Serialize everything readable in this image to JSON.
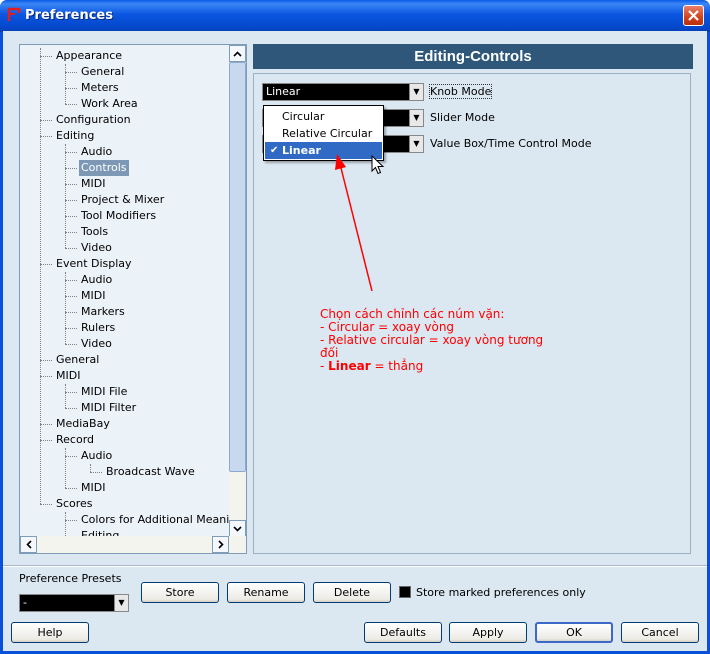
{
  "window": {
    "title": "Preferences"
  },
  "tree": {
    "items": [
      {
        "label": "Appearance",
        "level": 1
      },
      {
        "label": "General",
        "level": 2
      },
      {
        "label": "Meters",
        "level": 2
      },
      {
        "label": "Work Area",
        "level": 2
      },
      {
        "label": "Configuration",
        "level": 1
      },
      {
        "label": "Editing",
        "level": 1
      },
      {
        "label": "Audio",
        "level": 2
      },
      {
        "label": "Controls",
        "level": 2,
        "selected": true
      },
      {
        "label": "MIDI",
        "level": 2
      },
      {
        "label": "Project & Mixer",
        "level": 2
      },
      {
        "label": "Tool Modifiers",
        "level": 2
      },
      {
        "label": "Tools",
        "level": 2
      },
      {
        "label": "Video",
        "level": 2
      },
      {
        "label": "Event Display",
        "level": 1
      },
      {
        "label": "Audio",
        "level": 2
      },
      {
        "label": "MIDI",
        "level": 2
      },
      {
        "label": "Markers",
        "level": 2
      },
      {
        "label": "Rulers",
        "level": 2
      },
      {
        "label": "Video",
        "level": 2
      },
      {
        "label": "General",
        "level": 1
      },
      {
        "label": "MIDI",
        "level": 1
      },
      {
        "label": "MIDI File",
        "level": 2
      },
      {
        "label": "MIDI Filter",
        "level": 2
      },
      {
        "label": "MediaBay",
        "level": 1
      },
      {
        "label": "Record",
        "level": 1
      },
      {
        "label": "Audio",
        "level": 2
      },
      {
        "label": "Broadcast Wave",
        "level": 3
      },
      {
        "label": "MIDI",
        "level": 2
      },
      {
        "label": "Scores",
        "level": 1
      },
      {
        "label": "Colors for Additional Meanings",
        "level": 2
      },
      {
        "label": "Editing",
        "level": 2
      }
    ]
  },
  "panel": {
    "title": "Editing-Controls",
    "knob_mode": {
      "value": "Linear",
      "label": "Knob Mode"
    },
    "slider_mode": {
      "label": "Slider Mode"
    },
    "value_box_mode": {
      "label": "Value Box/Time Control Mode"
    },
    "dropdown": {
      "options": [
        "Circular",
        "Relative Circular",
        "Linear"
      ],
      "selected": "Linear"
    },
    "annotation": {
      "line1": "Chọn cách chỉnh các núm vặn:",
      "line2": "- Circular = xoay vòng",
      "line3": "- Relative circular = xoay vòng tương đối",
      "line4_prefix": "- ",
      "line4_bold": "Linear",
      "line4_suffix": " = thẳng",
      "color": "#ff0000"
    }
  },
  "presets": {
    "label": "Preference Presets",
    "value": "-",
    "store": "Store",
    "rename": "Rename",
    "delete": "Delete",
    "store_marked_label": "Store marked preferences only"
  },
  "footer": {
    "help": "Help",
    "defaults": "Defaults",
    "apply": "Apply",
    "ok": "OK",
    "cancel": "Cancel"
  }
}
